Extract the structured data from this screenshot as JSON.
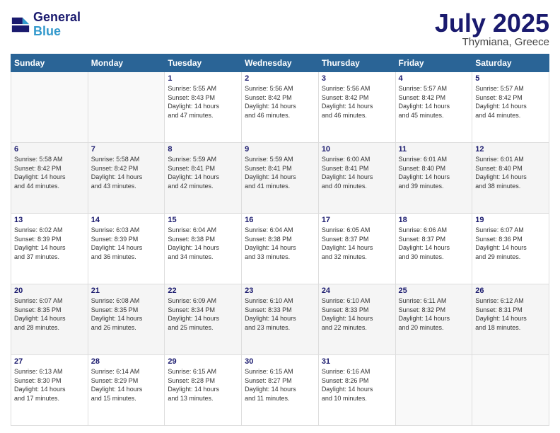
{
  "header": {
    "logo_line1": "General",
    "logo_line2": "Blue",
    "month_year": "July 2025",
    "location": "Thymiana, Greece"
  },
  "weekdays": [
    "Sunday",
    "Monday",
    "Tuesday",
    "Wednesday",
    "Thursday",
    "Friday",
    "Saturday"
  ],
  "weeks": [
    [
      {
        "day": "",
        "info": ""
      },
      {
        "day": "",
        "info": ""
      },
      {
        "day": "1",
        "info": "Sunrise: 5:55 AM\nSunset: 8:43 PM\nDaylight: 14 hours\nand 47 minutes."
      },
      {
        "day": "2",
        "info": "Sunrise: 5:56 AM\nSunset: 8:42 PM\nDaylight: 14 hours\nand 46 minutes."
      },
      {
        "day": "3",
        "info": "Sunrise: 5:56 AM\nSunset: 8:42 PM\nDaylight: 14 hours\nand 46 minutes."
      },
      {
        "day": "4",
        "info": "Sunrise: 5:57 AM\nSunset: 8:42 PM\nDaylight: 14 hours\nand 45 minutes."
      },
      {
        "day": "5",
        "info": "Sunrise: 5:57 AM\nSunset: 8:42 PM\nDaylight: 14 hours\nand 44 minutes."
      }
    ],
    [
      {
        "day": "6",
        "info": "Sunrise: 5:58 AM\nSunset: 8:42 PM\nDaylight: 14 hours\nand 44 minutes."
      },
      {
        "day": "7",
        "info": "Sunrise: 5:58 AM\nSunset: 8:42 PM\nDaylight: 14 hours\nand 43 minutes."
      },
      {
        "day": "8",
        "info": "Sunrise: 5:59 AM\nSunset: 8:41 PM\nDaylight: 14 hours\nand 42 minutes."
      },
      {
        "day": "9",
        "info": "Sunrise: 5:59 AM\nSunset: 8:41 PM\nDaylight: 14 hours\nand 41 minutes."
      },
      {
        "day": "10",
        "info": "Sunrise: 6:00 AM\nSunset: 8:41 PM\nDaylight: 14 hours\nand 40 minutes."
      },
      {
        "day": "11",
        "info": "Sunrise: 6:01 AM\nSunset: 8:40 PM\nDaylight: 14 hours\nand 39 minutes."
      },
      {
        "day": "12",
        "info": "Sunrise: 6:01 AM\nSunset: 8:40 PM\nDaylight: 14 hours\nand 38 minutes."
      }
    ],
    [
      {
        "day": "13",
        "info": "Sunrise: 6:02 AM\nSunset: 8:39 PM\nDaylight: 14 hours\nand 37 minutes."
      },
      {
        "day": "14",
        "info": "Sunrise: 6:03 AM\nSunset: 8:39 PM\nDaylight: 14 hours\nand 36 minutes."
      },
      {
        "day": "15",
        "info": "Sunrise: 6:04 AM\nSunset: 8:38 PM\nDaylight: 14 hours\nand 34 minutes."
      },
      {
        "day": "16",
        "info": "Sunrise: 6:04 AM\nSunset: 8:38 PM\nDaylight: 14 hours\nand 33 minutes."
      },
      {
        "day": "17",
        "info": "Sunrise: 6:05 AM\nSunset: 8:37 PM\nDaylight: 14 hours\nand 32 minutes."
      },
      {
        "day": "18",
        "info": "Sunrise: 6:06 AM\nSunset: 8:37 PM\nDaylight: 14 hours\nand 30 minutes."
      },
      {
        "day": "19",
        "info": "Sunrise: 6:07 AM\nSunset: 8:36 PM\nDaylight: 14 hours\nand 29 minutes."
      }
    ],
    [
      {
        "day": "20",
        "info": "Sunrise: 6:07 AM\nSunset: 8:35 PM\nDaylight: 14 hours\nand 28 minutes."
      },
      {
        "day": "21",
        "info": "Sunrise: 6:08 AM\nSunset: 8:35 PM\nDaylight: 14 hours\nand 26 minutes."
      },
      {
        "day": "22",
        "info": "Sunrise: 6:09 AM\nSunset: 8:34 PM\nDaylight: 14 hours\nand 25 minutes."
      },
      {
        "day": "23",
        "info": "Sunrise: 6:10 AM\nSunset: 8:33 PM\nDaylight: 14 hours\nand 23 minutes."
      },
      {
        "day": "24",
        "info": "Sunrise: 6:10 AM\nSunset: 8:33 PM\nDaylight: 14 hours\nand 22 minutes."
      },
      {
        "day": "25",
        "info": "Sunrise: 6:11 AM\nSunset: 8:32 PM\nDaylight: 14 hours\nand 20 minutes."
      },
      {
        "day": "26",
        "info": "Sunrise: 6:12 AM\nSunset: 8:31 PM\nDaylight: 14 hours\nand 18 minutes."
      }
    ],
    [
      {
        "day": "27",
        "info": "Sunrise: 6:13 AM\nSunset: 8:30 PM\nDaylight: 14 hours\nand 17 minutes."
      },
      {
        "day": "28",
        "info": "Sunrise: 6:14 AM\nSunset: 8:29 PM\nDaylight: 14 hours\nand 15 minutes."
      },
      {
        "day": "29",
        "info": "Sunrise: 6:15 AM\nSunset: 8:28 PM\nDaylight: 14 hours\nand 13 minutes."
      },
      {
        "day": "30",
        "info": "Sunrise: 6:15 AM\nSunset: 8:27 PM\nDaylight: 14 hours\nand 11 minutes."
      },
      {
        "day": "31",
        "info": "Sunrise: 6:16 AM\nSunset: 8:26 PM\nDaylight: 14 hours\nand 10 minutes."
      },
      {
        "day": "",
        "info": ""
      },
      {
        "day": "",
        "info": ""
      }
    ]
  ]
}
